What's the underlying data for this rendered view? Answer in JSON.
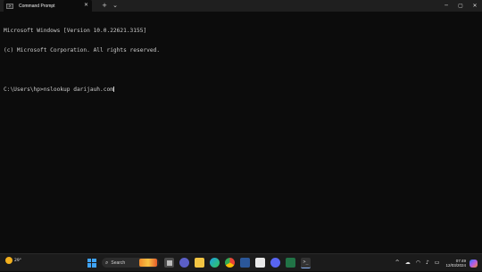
{
  "window": {
    "tab_title": "Command Prompt",
    "tab_close": "✕",
    "new_tab": "+",
    "dropdown": "⌄",
    "minimize": "─",
    "maximize": "▢",
    "close": "✕"
  },
  "terminal": {
    "lines": [
      "Microsoft Windows [Version 10.0.22621.3155]",
      "(c) Microsoft Corporation. All rights reserved.",
      "",
      "C:\\Users\\hp>nslookup darijauh.com"
    ]
  },
  "taskbar": {
    "weather_temp": "29°",
    "search_label": "Search",
    "search_glyph": "⌕",
    "tray": {
      "chevron": "^",
      "time": "07:49",
      "date": "12/03/2024"
    }
  },
  "colors": {
    "terminal_bg": "#0c0c0c",
    "terminal_text": "#cccccc",
    "titlebar_bg": "#1f1f1f",
    "taskbar_bg": "#1b1b1b",
    "accent": "#3fa3f5"
  },
  "icons": {
    "taskbar_apps": [
      "start-icon",
      "search-icon",
      "file-manager-icon",
      "teams-icon",
      "file-explorer-icon",
      "edge-icon",
      "chrome-icon",
      "word-icon",
      "app-icon",
      "discord-icon",
      "excel-icon",
      "terminal-icon"
    ],
    "tray": [
      "cloud-icon",
      "wifi-icon",
      "speaker-icon",
      "battery-icon",
      "copilot-icon"
    ]
  }
}
